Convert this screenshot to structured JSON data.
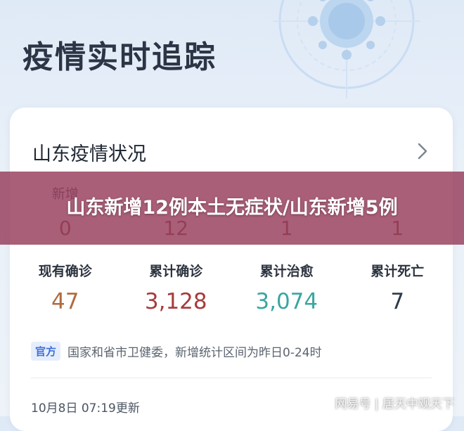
{
  "header": {
    "title": "疫情实时追踪"
  },
  "card": {
    "title": "山东疫情状况",
    "row1": {
      "labels": [
        "新增",
        "",
        "",
        ""
      ],
      "values": [
        "0",
        "12",
        "1",
        "1"
      ]
    },
    "row2": {
      "labels": [
        "现有确诊",
        "累计确诊",
        "累计治愈",
        "累计死亡"
      ],
      "values": [
        "47",
        "3,128",
        "3,074",
        "7"
      ],
      "colors": [
        "#b06a3e",
        "#a63b3b",
        "#3aa6a0",
        "#2e3a4a"
      ]
    },
    "source": {
      "badge": "官方",
      "text": "国家和省市卫健委，新增统计区间为昨日0-24时"
    },
    "update_time": "10月8日 07:19更新"
  },
  "banner": {
    "text": "山东新增12例本土无症状/山东新增5例"
  },
  "watermark": {
    "text": "网易号 | 居天中观天下"
  },
  "icons": [
    "virus-icon",
    "chevron-right-icon"
  ]
}
